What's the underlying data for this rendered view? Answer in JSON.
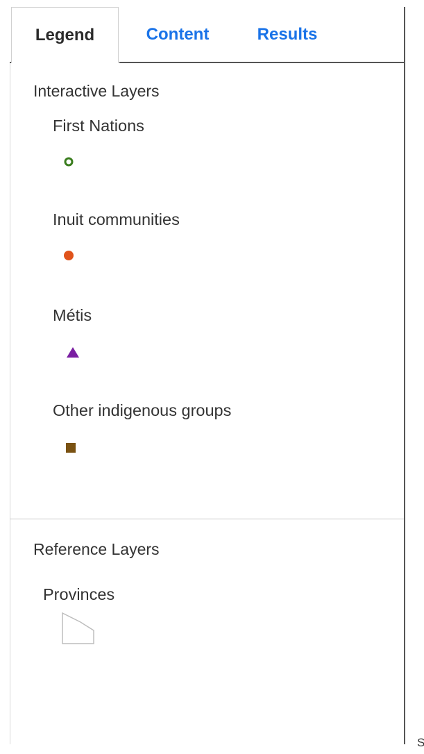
{
  "tabs": {
    "legend": "Legend",
    "content": "Content",
    "results": "Results"
  },
  "interactive": {
    "title": "Interactive Layers",
    "layers": [
      {
        "label": "First Nations",
        "symbol": "hollow-circle-icon",
        "color": "#3a7d1e"
      },
      {
        "label": "Inuit communities",
        "symbol": "filled-circle-icon",
        "color": "#e0531b"
      },
      {
        "label": "Métis",
        "symbol": "triangle-icon",
        "color": "#7a1fa2"
      },
      {
        "label": "Other indigenous groups",
        "symbol": "square-icon",
        "color": "#7a5212"
      }
    ]
  },
  "reference": {
    "title": "Reference Layers",
    "layers": [
      {
        "label": "Provinces",
        "symbol": "polygon-outline-icon",
        "color": "#bdbdbd"
      }
    ]
  },
  "edge_text": "S"
}
